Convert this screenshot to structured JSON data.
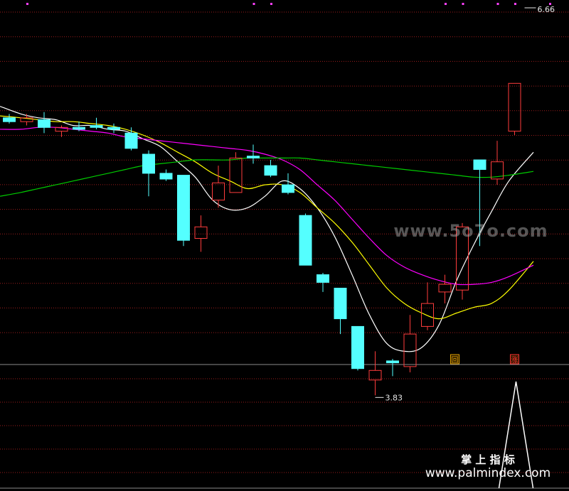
{
  "chart_data": {
    "type": "candlestick",
    "price_range": [
      3.83,
      6.66
    ],
    "annotations": {
      "high_label": "6.66",
      "low_label": "3.83"
    },
    "candles": [
      {
        "o": 5.03,
        "c": 5.01,
        "h": 5.05,
        "l": 5.0
      },
      {
        "o": 5.01,
        "c": 5.03,
        "h": 5.05,
        "l": 4.99
      },
      {
        "o": 5.02,
        "c": 4.98,
        "h": 5.06,
        "l": 4.95
      },
      {
        "o": 4.96,
        "c": 4.98,
        "h": 4.99,
        "l": 4.93
      },
      {
        "o": 4.98,
        "c": 4.97,
        "h": 5.01,
        "l": 4.96
      },
      {
        "o": 4.99,
        "c": 4.98,
        "h": 5.03,
        "l": 4.97
      },
      {
        "o": 4.98,
        "c": 4.97,
        "h": 5.0,
        "l": 4.95
      },
      {
        "o": 4.95,
        "c": 4.87,
        "h": 4.98,
        "l": 4.86
      },
      {
        "o": 4.84,
        "c": 4.74,
        "h": 4.86,
        "l": 4.62
      },
      {
        "o": 4.74,
        "c": 4.71,
        "h": 4.76,
        "l": 4.7
      },
      {
        "o": 4.73,
        "c": 4.39,
        "h": 4.73,
        "l": 4.36
      },
      {
        "o": 4.4,
        "c": 4.46,
        "h": 4.52,
        "l": 4.33
      },
      {
        "o": 4.6,
        "c": 4.69,
        "h": 4.78,
        "l": 4.56
      },
      {
        "o": 4.64,
        "c": 4.82,
        "h": 4.85,
        "l": 4.64
      },
      {
        "o": 4.83,
        "c": 4.82,
        "h": 4.89,
        "l": 4.79
      },
      {
        "o": 4.78,
        "c": 4.73,
        "h": 4.81,
        "l": 4.72
      },
      {
        "o": 4.68,
        "c": 4.64,
        "h": 4.74,
        "l": 4.63
      },
      {
        "o": 4.52,
        "c": 4.26,
        "h": 4.53,
        "l": 4.26
      },
      {
        "o": 4.21,
        "c": 4.17,
        "h": 4.22,
        "l": 4.12
      },
      {
        "o": 4.14,
        "c": 3.98,
        "h": 4.14,
        "l": 3.9
      },
      {
        "o": 3.94,
        "c": 3.72,
        "h": 3.94,
        "l": 3.71
      },
      {
        "o": 3.66,
        "c": 3.71,
        "h": 3.81,
        "l": 3.58
      },
      {
        "o": 3.76,
        "c": 3.75,
        "h": 3.77,
        "l": 3.68
      },
      {
        "o": 3.73,
        "c": 3.9,
        "h": 4.0,
        "l": 3.7
      },
      {
        "o": 3.94,
        "c": 4.06,
        "h": 4.17,
        "l": 3.92
      },
      {
        "o": 4.12,
        "c": 4.16,
        "h": 4.21,
        "l": 4.06
      },
      {
        "o": 4.13,
        "c": 4.46,
        "h": 4.48,
        "l": 4.08
      },
      {
        "o": 4.81,
        "c": 4.76,
        "h": 4.81,
        "l": 4.36
      },
      {
        "o": 4.71,
        "c": 4.8,
        "h": 4.91,
        "l": 4.68
      },
      {
        "o": 4.96,
        "c": 5.21,
        "h": 5.21,
        "l": 4.94
      }
    ],
    "moving_averages": [
      {
        "color": "#ffffff",
        "values": [
          5.09,
          5.05,
          5.03,
          5.02,
          4.99,
          4.99,
          4.97,
          4.96,
          4.92,
          4.88,
          4.8,
          4.72,
          4.6,
          4.55,
          4.56,
          4.62,
          4.7,
          4.66,
          4.56,
          4.41,
          4.21,
          4.0,
          3.85,
          3.81,
          3.83,
          3.95,
          4.18,
          4.37,
          4.54,
          4.7,
          4.85
        ]
      },
      {
        "color": "#ffff00",
        "values": [
          5.04,
          5.03,
          5.02,
          5.01,
          5.01,
          5.0,
          4.99,
          4.97,
          4.94,
          4.9,
          4.85,
          4.8,
          4.74,
          4.7,
          4.66,
          4.68,
          4.68,
          4.64,
          4.56,
          4.48,
          4.38,
          4.26,
          4.14,
          4.06,
          4.01,
          3.98,
          4.01,
          4.04,
          4.06,
          4.13,
          4.28
        ]
      },
      {
        "color": "#ff00ff",
        "values": [
          4.97,
          4.97,
          4.98,
          4.98,
          4.97,
          4.96,
          4.95,
          4.93,
          4.92,
          4.91,
          4.9,
          4.89,
          4.88,
          4.87,
          4.86,
          4.84,
          4.81,
          4.76,
          4.68,
          4.6,
          4.5,
          4.4,
          4.31,
          4.25,
          4.21,
          4.18,
          4.16,
          4.16,
          4.17,
          4.2,
          4.26
        ]
      },
      {
        "color": "#00cc00",
        "values": [
          4.62,
          4.64,
          4.66,
          4.68,
          4.7,
          4.72,
          4.74,
          4.76,
          4.78,
          4.79,
          4.8,
          4.81,
          4.81,
          4.81,
          4.82,
          4.82,
          4.82,
          4.82,
          4.81,
          4.8,
          4.79,
          4.78,
          4.77,
          4.76,
          4.75,
          4.74,
          4.73,
          4.72,
          4.72,
          4.73,
          4.75
        ]
      }
    ],
    "top_markers": [
      0,
      13,
      14,
      24,
      25,
      27,
      28,
      30
    ],
    "signals": [
      {
        "index": 25,
        "text": "回",
        "color": "#e0a000"
      },
      {
        "index": 29,
        "text": "涨",
        "color": "#ff3030"
      }
    ],
    "indicator": {
      "color": "#ffffff",
      "peak_index": 29,
      "peak_value": 1.0
    }
  },
  "watermark": {
    "site1": "www.5o7o.com",
    "cn_name": "掌 上 指 标",
    "site2": "www.palmindex.com"
  }
}
